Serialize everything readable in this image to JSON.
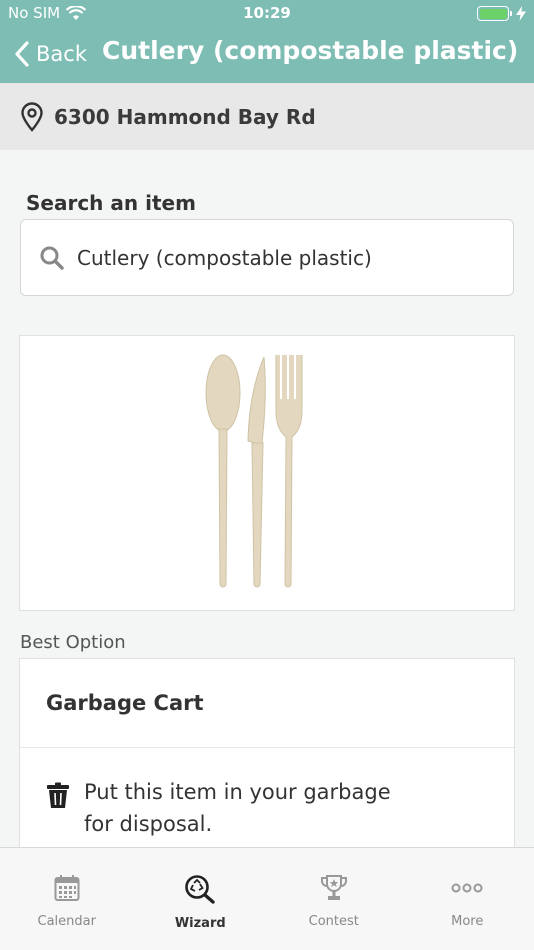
{
  "status_bar": {
    "carrier": "No SIM",
    "time": "10:29",
    "battery_level": 1.0
  },
  "nav": {
    "back_label": "Back",
    "title": "Cutlery (compostable plastic)"
  },
  "location": {
    "address": "6300 Hammond Bay Rd",
    "icon": "location-pin-icon"
  },
  "search": {
    "label": "Search an item",
    "value": "Cutlery (compostable plastic)",
    "icon": "search-icon"
  },
  "item_image": {
    "description_icon": "cutlery-image"
  },
  "best_option": {
    "section_label": "Best Option",
    "title": "Garbage Cart",
    "description": "Put this item in your garbage for disposal.",
    "icon": "garbage-bin-icon"
  },
  "tabbar": {
    "tabs": [
      {
        "label": "Calendar",
        "icon": "calendar-icon",
        "active": false
      },
      {
        "label": "Wizard",
        "icon": "wizard-search-icon",
        "active": true
      },
      {
        "label": "Contest",
        "icon": "trophy-icon",
        "active": false
      },
      {
        "label": "More",
        "icon": "more-icon",
        "active": false
      }
    ]
  },
  "colors": {
    "header": "#7dbdb3",
    "battery": "#6dd16a",
    "background": "#f4f6f6"
  }
}
